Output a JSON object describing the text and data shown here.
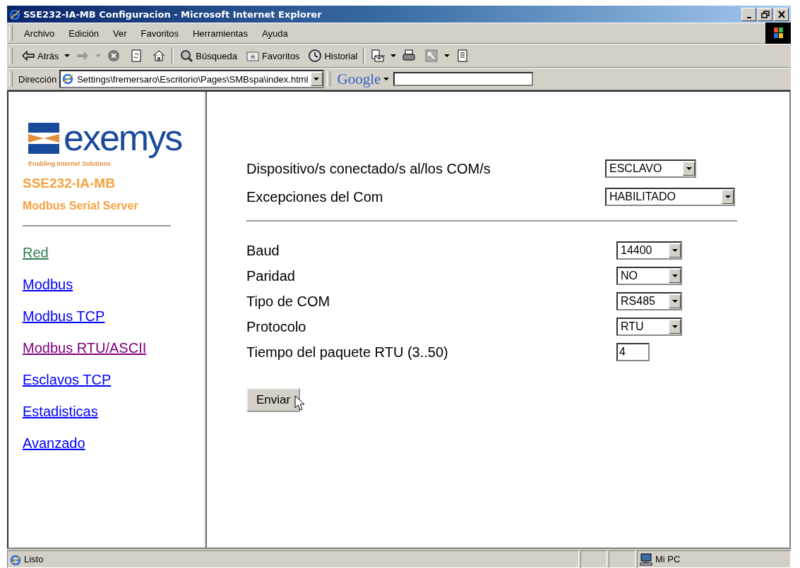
{
  "window": {
    "title": "SSE232-IA-MB Configuracion - Microsoft Internet Explorer"
  },
  "menu": [
    "Archivo",
    "Edición",
    "Ver",
    "Favoritos",
    "Herramientas",
    "Ayuda"
  ],
  "toolbar": [
    {
      "kind": "back",
      "label": "Atrás"
    },
    {
      "kind": "forward"
    },
    {
      "kind": "stop"
    },
    {
      "kind": "refresh"
    },
    {
      "kind": "home"
    },
    {
      "kind": "sep"
    },
    {
      "kind": "search",
      "label": "Búsqueda"
    },
    {
      "kind": "favorites",
      "label": "Favoritos"
    },
    {
      "kind": "history",
      "label": "Historial"
    },
    {
      "kind": "sep"
    },
    {
      "kind": "mail"
    },
    {
      "kind": "print"
    },
    {
      "kind": "edit"
    },
    {
      "kind": "discuss"
    }
  ],
  "address": {
    "label": "Dirección",
    "url": "Settings\\fremersaro\\Escritorio\\Pages\\SMBspa\\index.html"
  },
  "google": {
    "label": "Google"
  },
  "sidebar": {
    "logo": "exemys",
    "tagline": "Enabling Internet Solutions",
    "product": "SSE232-IA-MB",
    "subtitle": "Modbus Serial Server",
    "links": [
      {
        "label": "Red",
        "color": "#2e7d4f"
      },
      {
        "label": "Modbus",
        "color": "#0000ff"
      },
      {
        "label": "Modbus TCP",
        "color": "#0000ff"
      },
      {
        "label": "Modbus RTU/ASCII",
        "color": "#800080"
      },
      {
        "label": "Esclavos TCP",
        "color": "#0000ff"
      },
      {
        "label": "Estadisticas",
        "color": "#0000ff"
      },
      {
        "label": "Avanzado",
        "color": "#0000ff"
      }
    ]
  },
  "form": {
    "groups": [
      {
        "rows": [
          {
            "label": "Dispositivo/s conectado/s al/los COM/s",
            "kind": "select",
            "value": "ESCLAVO"
          },
          {
            "label": "Excepciones del Com",
            "kind": "select",
            "value": "HABILITADO"
          }
        ]
      },
      {
        "rows": [
          {
            "label": "Baud",
            "kind": "select",
            "value": "14400"
          },
          {
            "label": "Paridad",
            "kind": "select",
            "value": "NO"
          },
          {
            "label": "Tipo de COM",
            "kind": "select",
            "value": "RS485"
          },
          {
            "label": "Protocolo",
            "kind": "select",
            "value": "RTU"
          },
          {
            "label": "Tiempo del paquete RTU (3..50)",
            "kind": "input",
            "value": "4"
          }
        ]
      }
    ],
    "submit": "Enviar"
  },
  "status_bar": {
    "text": "Listo",
    "zone": "Mi PC"
  }
}
